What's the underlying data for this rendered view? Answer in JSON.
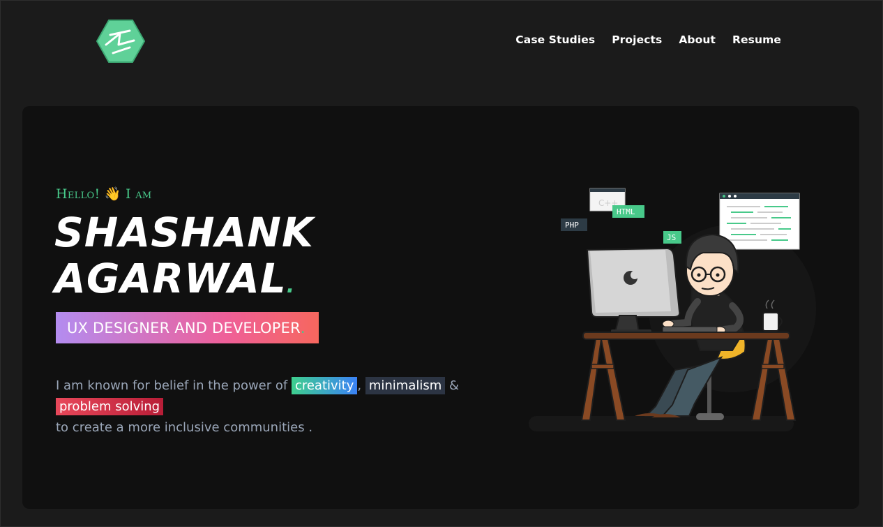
{
  "header": {
    "nav": [
      {
        "label": "Case Studies"
      },
      {
        "label": "Projects"
      },
      {
        "label": "About"
      },
      {
        "label": "Resume"
      }
    ]
  },
  "hero": {
    "greeting": "Hello! 👋 I am",
    "name_line1": "SHASHANK",
    "name_line2": "AGARWAL",
    "name_dot": ".",
    "role": "UX DESIGNER AND DEVELOPER",
    "role_dot": ".",
    "about": {
      "lead": "I am known for belief in the power of",
      "word1": "creativity",
      "sep1": ",",
      "word2": "minimalism",
      "amp": "&",
      "word3": "problem solving",
      "tail": "to create a more inclusive communities ."
    },
    "illustration": {
      "labels": {
        "php": "PHP",
        "html": "HTML",
        "js": "JS",
        "cpp": "C++"
      }
    }
  },
  "colors": {
    "accent": "#48c98a",
    "background": "#1b1b1b",
    "card": "#101010"
  }
}
